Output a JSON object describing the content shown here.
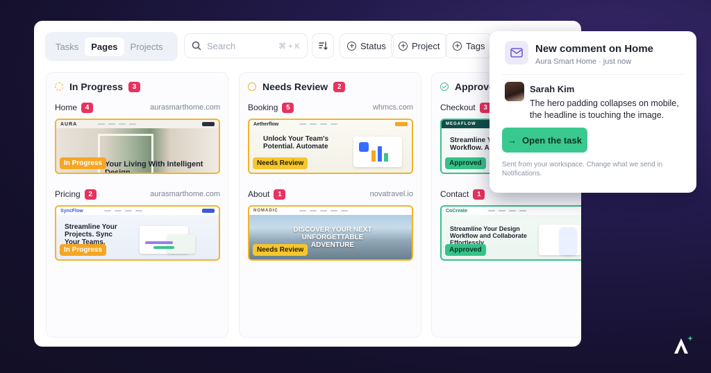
{
  "toolbar": {
    "tabs": [
      {
        "label": "Tasks",
        "active": false
      },
      {
        "label": "Pages",
        "active": true
      },
      {
        "label": "Projects",
        "active": false
      }
    ],
    "search": {
      "placeholder": "Search",
      "shortcut": "⌘ + K"
    },
    "filters": [
      "Status",
      "Project",
      "Tags"
    ]
  },
  "columns": [
    {
      "title": "In Progress",
      "count": "3",
      "status": "progress",
      "cards": [
        {
          "name": "Home",
          "count": "4",
          "domain": "aurasmarthome.com",
          "pill": "In Progress",
          "thumb_text": "Your Living With Intelligent Design",
          "logo": "AURA"
        },
        {
          "name": "Pricing",
          "count": "2",
          "domain": "aurasmarthome.com",
          "pill": "In Progress",
          "thumb_text": "Streamline Your Projects. Sync Your Teams.",
          "logo": "SyncFlow"
        }
      ]
    },
    {
      "title": "Needs Review",
      "count": "2",
      "status": "review",
      "cards": [
        {
          "name": "Booking",
          "count": "5",
          "domain": "whmcs.com",
          "pill": "Needs Review",
          "thumb_text": "Unlock Your Team's Potential. Automate",
          "logo": "Aetherflow"
        },
        {
          "name": "About",
          "count": "1",
          "domain": "novatravel.io",
          "pill": "Needs Review",
          "thumb_text": "DISCOVER YOUR NEXT UNFORGETTABLE ADVENTURE",
          "logo": "NOMADIC"
        }
      ]
    },
    {
      "title": "Approved",
      "count": "",
      "status": "approved",
      "cards": [
        {
          "name": "Checkout",
          "count": "3",
          "domain": "",
          "pill": "Approved",
          "thumb_text": "Streamline Your Workflow. Ar Growth",
          "logo": "MEGAFLOW"
        },
        {
          "name": "Contact",
          "count": "1",
          "domain": "",
          "pill": "Approved",
          "thumb_text": "Streamline Your Design Workflow and Collaborate Effortlessly",
          "logo": "CoCreate"
        }
      ]
    }
  ],
  "notification": {
    "title": "New comment on Home",
    "subtitle": "Aura Smart Home · just now",
    "commenter": "Sarah Kim",
    "comment": "The hero padding collapses on mobile, the headline is touching the image.",
    "button": "Open the task",
    "footer": "Sent from your workspace. Change what we send in Notifications."
  },
  "colors": {
    "progress": "#f5a623",
    "review": "#f6c62e",
    "approved": "#36c28a",
    "badge": "#e8325f",
    "accent": "#39c98f"
  },
  "icons": [
    "search-icon",
    "sort-icon",
    "plus-circle-icon",
    "mail-icon",
    "arrow-right-icon",
    "brand-logo-icon"
  ]
}
